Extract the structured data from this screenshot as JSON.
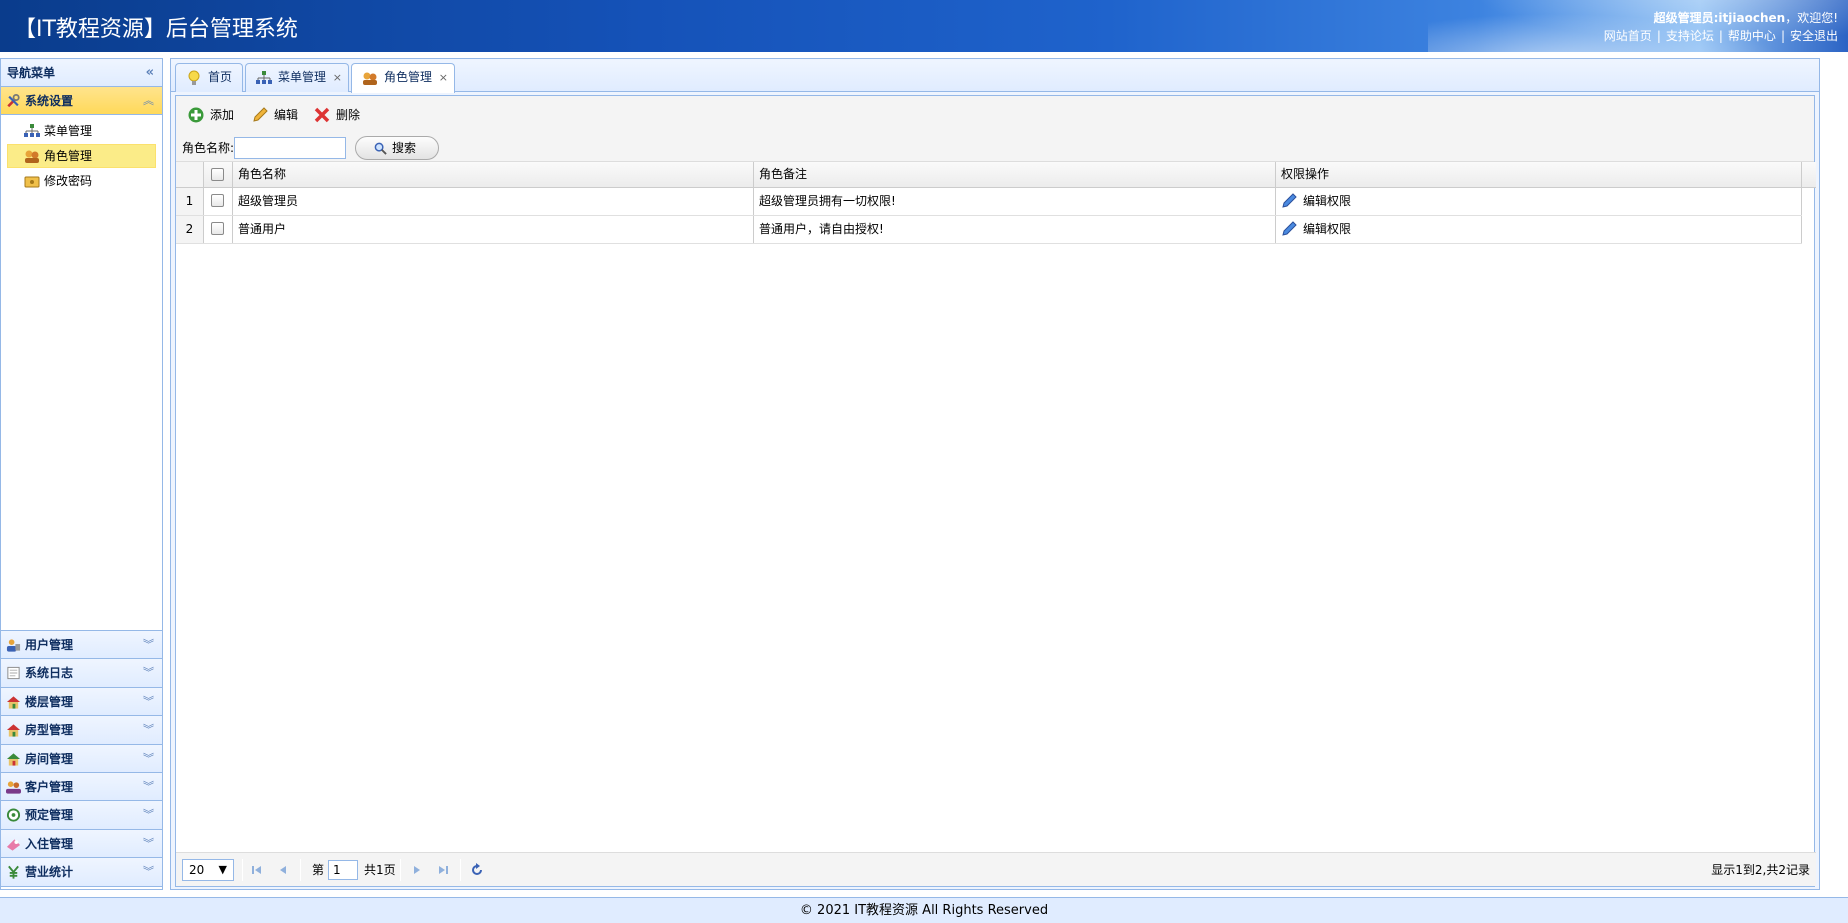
{
  "header": {
    "title": "【IT教程资源】后台管理系统",
    "user_label": "超级管理员:itjiaochen",
    "welcome": "，欢迎您!",
    "links": [
      "网站首页",
      "支持论坛",
      "帮助中心",
      "安全退出"
    ]
  },
  "nav": {
    "title": "导航菜单",
    "active_section": {
      "label": "系统设置",
      "icon": "tools-icon"
    },
    "tree": [
      {
        "label": "菜单管理",
        "icon": "sitemap-icon",
        "selected": false
      },
      {
        "label": "角色管理",
        "icon": "role-icon",
        "selected": true
      },
      {
        "label": "修改密码",
        "icon": "password-icon",
        "selected": false
      }
    ],
    "sections": [
      {
        "label": "用户管理",
        "icon": "user-icon"
      },
      {
        "label": "系统日志",
        "icon": "log-icon"
      },
      {
        "label": "楼层管理",
        "icon": "house-icon"
      },
      {
        "label": "房型管理",
        "icon": "house-icon"
      },
      {
        "label": "房间管理",
        "icon": "house-icon"
      },
      {
        "label": "客户管理",
        "icon": "customer-icon"
      },
      {
        "label": "预定管理",
        "icon": "reserve-icon"
      },
      {
        "label": "入住管理",
        "icon": "checkin-icon"
      },
      {
        "label": "营业统计",
        "icon": "yen-icon"
      }
    ]
  },
  "tabs": [
    {
      "label": "首页",
      "icon": "bulb-icon",
      "closable": false
    },
    {
      "label": "菜单管理",
      "icon": "sitemap-icon",
      "closable": true
    },
    {
      "label": "角色管理",
      "icon": "role-icon",
      "closable": true,
      "active": true
    }
  ],
  "toolbar": {
    "add_label": "添加",
    "edit_label": "编辑",
    "delete_label": "删除",
    "search_label": "角色名称:",
    "search_value": "",
    "search_button": "搜索"
  },
  "grid": {
    "columns": [
      "角色名称",
      "角色备注",
      "权限操作"
    ],
    "rows": [
      {
        "num": "1",
        "name": "超级管理员",
        "remark": "超级管理员拥有一切权限!",
        "action": "编辑权限"
      },
      {
        "num": "2",
        "name": "普通用户",
        "remark": "普通用户，请自由授权!",
        "action": "编辑权限"
      }
    ]
  },
  "pager": {
    "page_size": "20",
    "page_prefix": "第",
    "current_page": "1",
    "page_total": "共1页",
    "info": "显示1到2,共2记录"
  },
  "footer": {
    "text": "© 2021 IT教程资源 All Rights Reserved"
  },
  "colors": {
    "accent": "#95b8e7",
    "selected": "#fbec88",
    "header_blue": "#1552b8"
  }
}
